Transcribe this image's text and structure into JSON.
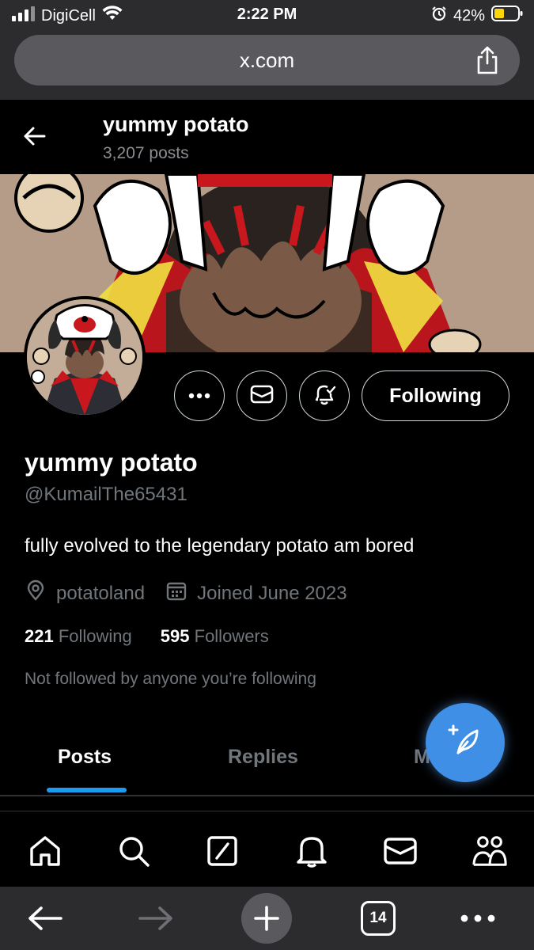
{
  "status_bar": {
    "carrier": "DigiCell",
    "time": "2:22 PM",
    "battery": "42%",
    "icons": [
      "signal-icon",
      "wifi-icon",
      "alarm-icon",
      "battery-icon"
    ]
  },
  "browser": {
    "url": "x.com",
    "tab_count": "14"
  },
  "header": {
    "title": "yummy potato",
    "post_count": "3,207 posts"
  },
  "profile": {
    "name": "yummy potato",
    "handle": "@KumailThe65431",
    "bio": "fully evolved to the legendary potato am bored",
    "location": "potatoland",
    "joined": "Joined June 2023",
    "following_count": "221",
    "following_label": "Following",
    "followers_count": "595",
    "followers_label": "Followers",
    "not_followed_text": "Not followed by anyone you’re following",
    "follow_button": "Following"
  },
  "tabs": [
    {
      "label": "Posts",
      "active": true
    },
    {
      "label": "Replies",
      "active": false
    },
    {
      "label": "M",
      "active": false
    }
  ],
  "colors": {
    "accent": "#1d9bf0",
    "fab": "#3f8fe6",
    "chrome": "#2c2c2e"
  }
}
